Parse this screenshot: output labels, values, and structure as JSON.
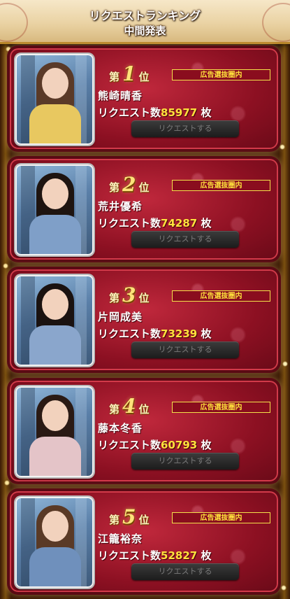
{
  "header": {
    "title": "リクエストランキング",
    "subtitle": "中間発表"
  },
  "labels": {
    "rank_prefix": "第",
    "rank_suffix": "位",
    "count_prefix": "リクエスト数",
    "count_unit": "枚",
    "request_button": "リクエストする",
    "badge": "広告選抜圏内"
  },
  "entries": [
    {
      "rank": "1",
      "name": "熊崎晴香",
      "count": "85977"
    },
    {
      "rank": "2",
      "name": "荒井優希",
      "count": "74287"
    },
    {
      "rank": "3",
      "name": "片岡成美",
      "count": "73239"
    },
    {
      "rank": "4",
      "name": "藤本冬香",
      "count": "60793"
    },
    {
      "rank": "5",
      "name": "江籠裕奈",
      "count": "52827"
    }
  ],
  "colors": {
    "card_red": "#8c1022",
    "badge_text": "#ffe23c",
    "count_number": "#ffe23c",
    "button_dark": "#2a2a2a"
  }
}
